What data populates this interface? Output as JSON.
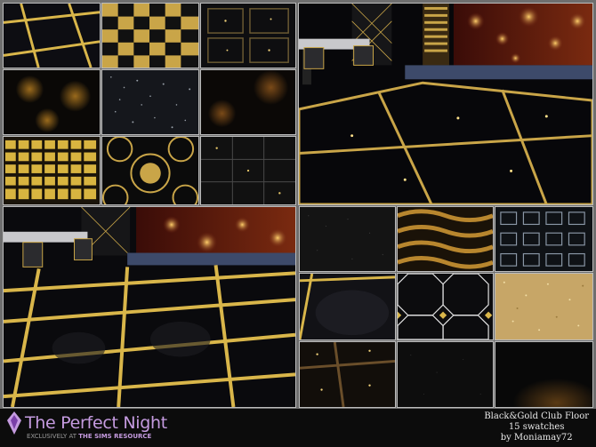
{
  "brand": {
    "title": "The Perfect Night",
    "subtitle_prefix": "EXCLUSIVELY AT",
    "subtitle_name": "THE SIMS RESOURCE",
    "accent_color": "#c59be0"
  },
  "caption": {
    "line1": "Black&Gold Club Floor",
    "line2": "15 swatches",
    "line3": "by Moniamay72"
  },
  "palette": {
    "gold": "#d4af37",
    "black": "#0b0b0d"
  }
}
